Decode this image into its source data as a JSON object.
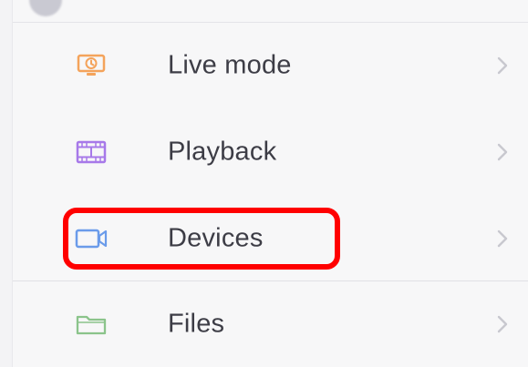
{
  "menu": {
    "items": [
      {
        "label": "Live mode",
        "icon": "monitor-icon",
        "icon_color": "#f4a35b",
        "chevron": "chevron-right-icon"
      },
      {
        "label": "Playback",
        "icon": "film-icon",
        "icon_color": "#a779e9",
        "chevron": "chevron-right-icon"
      },
      {
        "label": "Devices",
        "icon": "video-camera-icon",
        "icon_color": "#6a9bea",
        "chevron": "chevron-right-icon"
      },
      {
        "label": "Files",
        "icon": "folder-icon",
        "icon_color": "#8bc48b",
        "chevron": "chevron-right-icon"
      }
    ]
  },
  "colors": {
    "text": "#3d3d46",
    "chevron": "#c8c8cf",
    "highlight": "#ff0000",
    "background": "#f7f7f8"
  }
}
